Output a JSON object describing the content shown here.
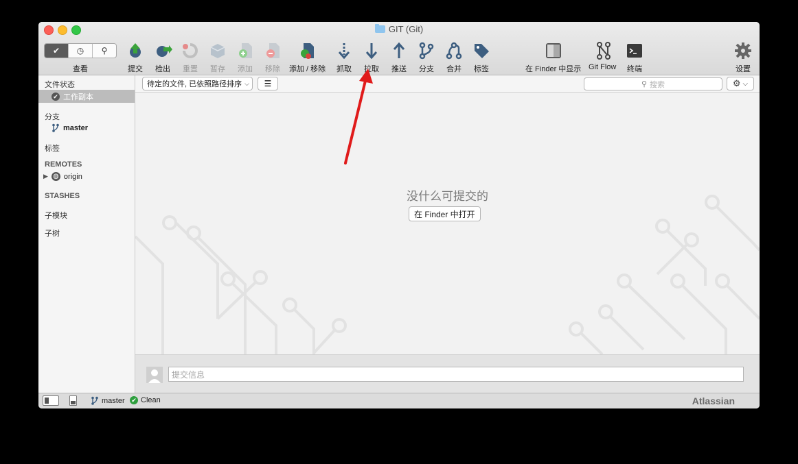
{
  "window": {
    "title": "GIT (Git)"
  },
  "toolbar": {
    "view_label": "查看",
    "items": [
      {
        "label": "提交",
        "icon": "commit-icon",
        "disabled": false
      },
      {
        "label": "检出",
        "icon": "checkout-icon",
        "disabled": false
      },
      {
        "label": "重置",
        "icon": "reset-icon",
        "disabled": true
      },
      {
        "label": "暂存",
        "icon": "stash-icon",
        "disabled": true
      },
      {
        "label": "添加",
        "icon": "add-icon",
        "disabled": true
      },
      {
        "label": "移除",
        "icon": "remove-icon",
        "disabled": true
      },
      {
        "label": "添加 / 移除",
        "icon": "add-remove-icon",
        "disabled": false
      },
      {
        "label": "抓取",
        "icon": "fetch-icon",
        "disabled": false
      },
      {
        "label": "拉取",
        "icon": "pull-icon",
        "disabled": false
      },
      {
        "label": "推送",
        "icon": "push-icon",
        "disabled": false
      },
      {
        "label": "分支",
        "icon": "branch-icon",
        "disabled": false
      },
      {
        "label": "合并",
        "icon": "merge-icon",
        "disabled": false
      },
      {
        "label": "标签",
        "icon": "tag-icon",
        "disabled": false
      },
      {
        "label": "在 Finder 中显示",
        "icon": "finder-icon",
        "disabled": false
      },
      {
        "label": "Git Flow",
        "icon": "git-flow-icon",
        "disabled": false
      },
      {
        "label": "终端",
        "icon": "terminal-icon",
        "disabled": false
      },
      {
        "label": "设置",
        "icon": "settings-icon",
        "disabled": false
      }
    ]
  },
  "sidebar": {
    "file_status": "文件状态",
    "working_copy": "工作副本",
    "branches": "分支",
    "branch_master": "master",
    "tags": "标签",
    "remotes": "REMOTES",
    "remote_origin": "origin",
    "stashes": "STASHES",
    "submodules": "子模块",
    "subtrees": "子树"
  },
  "filter": {
    "dropdown_value": "待定的文件, 已依照路径排序",
    "search_placeholder": "搜索"
  },
  "main": {
    "empty_message": "没什么可提交的",
    "open_in_finder": "在 Finder 中打开"
  },
  "commit": {
    "placeholder": "提交信息"
  },
  "status": {
    "branch": "master",
    "clean": "Clean",
    "brand": "Atlassian"
  },
  "colors": {
    "annotation_arrow": "#e01b1b",
    "clean_green": "#2e9f3e",
    "icon_blue": "#3d5e80"
  }
}
